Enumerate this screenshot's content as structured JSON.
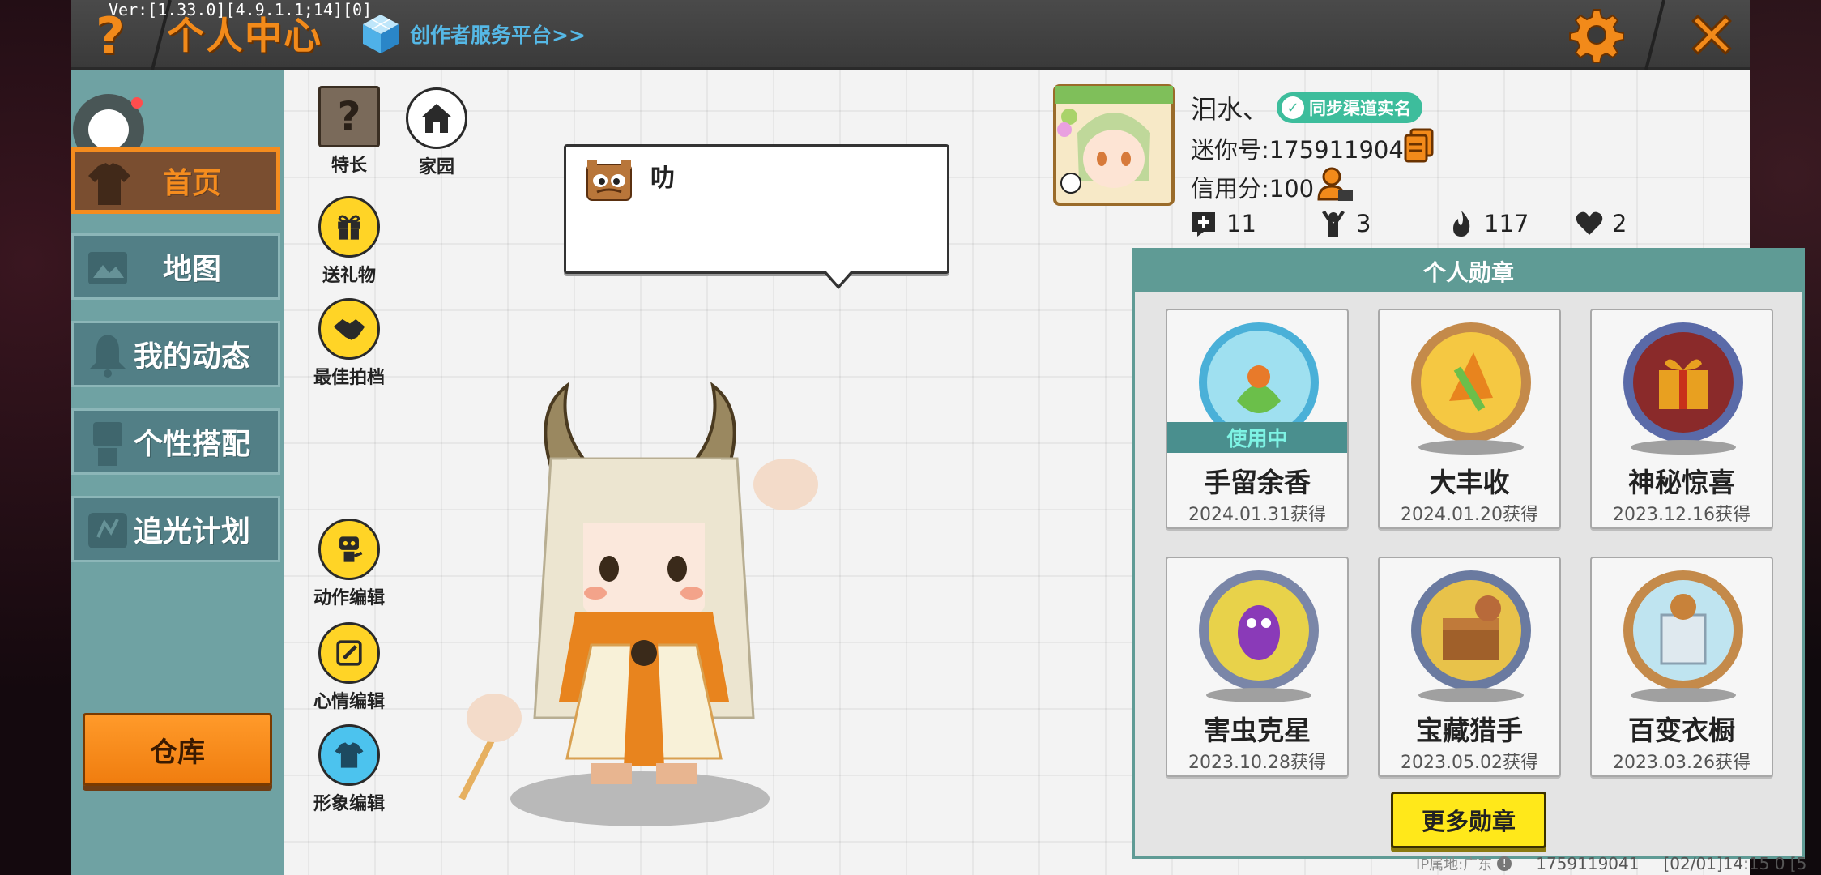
{
  "version": "Ver:[1.33.0][4.9.1.1;14][0]",
  "header": {
    "help_icon": "?",
    "title": "个人中心",
    "creator_link": "创作者服务平台>>",
    "settings_icon": "gear-icon",
    "close_icon": "close-icon"
  },
  "sidebar": {
    "items": [
      {
        "label": "首页",
        "active": true,
        "icon": "shirt-icon"
      },
      {
        "label": "地图",
        "active": false,
        "icon": "map-icon"
      },
      {
        "label": "我的动态",
        "active": false,
        "icon": "bell-icon"
      },
      {
        "label": "个性搭配",
        "active": false,
        "icon": "character-icon"
      },
      {
        "label": "追光计划",
        "active": false,
        "icon": "light-plan-icon"
      }
    ],
    "warehouse_label": "仓库"
  },
  "tools": {
    "talent": "特长",
    "home": "家园",
    "gift": "送礼物",
    "partner": "最佳拍档",
    "action_edit": "动作编辑",
    "mood_edit": "心情编辑",
    "look_edit": "形象编辑"
  },
  "speech": {
    "text": "叻"
  },
  "profile": {
    "nickname": "汩水、",
    "sync_badge": "同步渠道实名",
    "mini_id": "迷你号:1759119041",
    "credit": "信用分:100",
    "stats": [
      {
        "icon": "add-friend-icon",
        "value": "11"
      },
      {
        "icon": "fans-icon",
        "value": "3"
      },
      {
        "icon": "fire-icon",
        "value": "117"
      },
      {
        "icon": "hearts-icon",
        "value": "2"
      }
    ]
  },
  "badges": {
    "title": "个人勋章",
    "in_use_label": "使用中",
    "items": [
      {
        "name": "手留余香",
        "date": "2024.01.31获得",
        "in_use": true
      },
      {
        "name": "大丰收",
        "date": "2024.01.20获得",
        "in_use": false
      },
      {
        "name": "神秘惊喜",
        "date": "2023.12.16获得",
        "in_use": false
      },
      {
        "name": "害虫克星",
        "date": "2023.10.28获得",
        "in_use": false
      },
      {
        "name": "宝藏猎手",
        "date": "2023.05.02获得",
        "in_use": false
      },
      {
        "name": "百变衣橱",
        "date": "2023.03.26获得",
        "in_use": false
      }
    ],
    "more_label": "更多勋章"
  },
  "footer": {
    "ip": "IP属地:广东",
    "uid": "1759119041",
    "time": "[02/01]14:15 0 [5"
  },
  "colors": {
    "accent_orange": "#f28a1a",
    "nav_teal": "#6fa2a3",
    "badge_header": "#5f9b95",
    "button_yellow": "#ffe81a"
  }
}
